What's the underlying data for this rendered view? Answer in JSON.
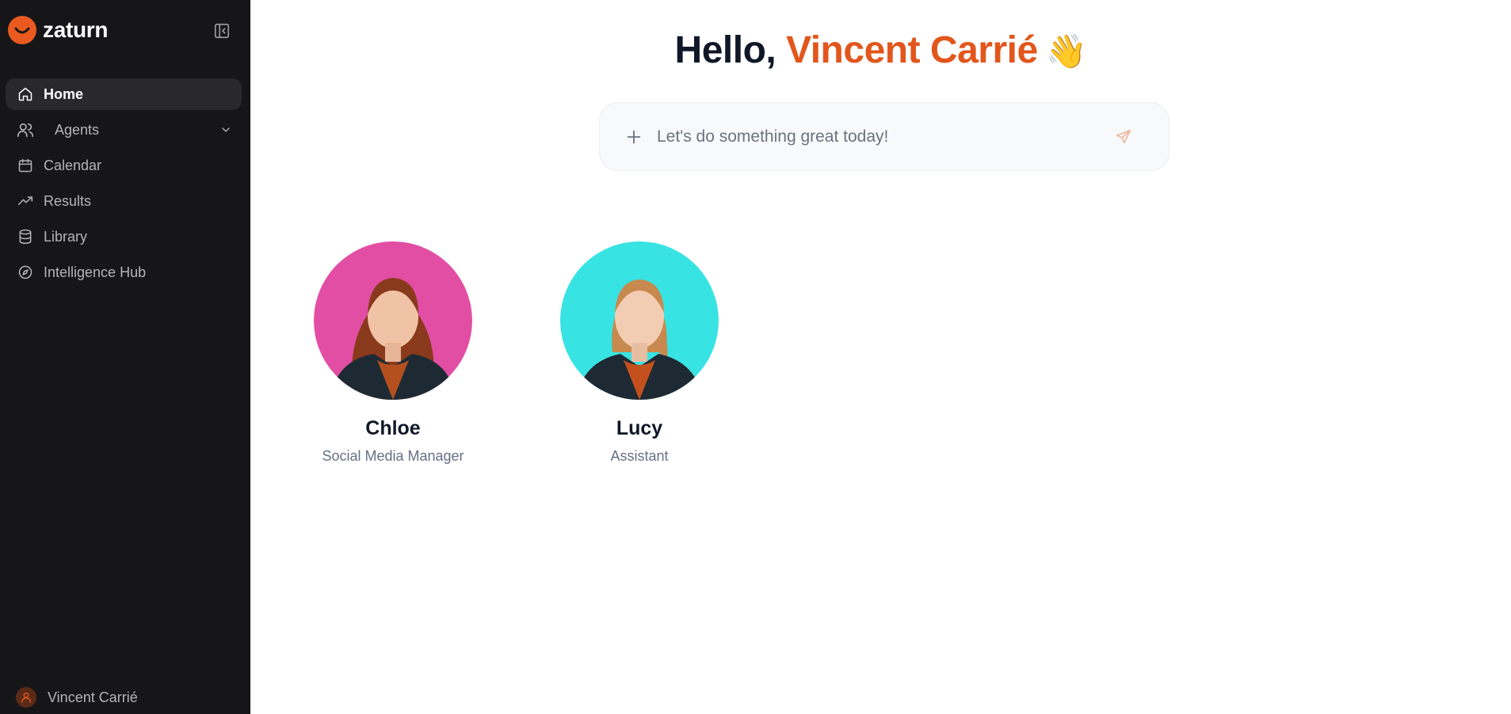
{
  "brand": {
    "name": "zaturn",
    "accent": "#ea5a20"
  },
  "sidebar": {
    "items": [
      {
        "label": "Home",
        "icon": "home-icon",
        "active": true
      },
      {
        "label": "Agents",
        "icon": "users-icon"
      },
      {
        "label": "Calendar",
        "icon": "calendar-icon"
      },
      {
        "label": "Results",
        "icon": "trending-up-icon"
      },
      {
        "label": "Library",
        "icon": "database-icon"
      },
      {
        "label": "Intelligence Hub",
        "icon": "compass-icon"
      }
    ],
    "user": {
      "name": "Vincent Carrié"
    }
  },
  "main": {
    "greeting": {
      "prefix": "Hello, ",
      "name": "Vincent Carrié",
      "emoji": "👋"
    },
    "prompt": {
      "placeholder": "Let's do something great today!"
    },
    "agents": [
      {
        "name": "Chloe",
        "role": "Social Media Manager",
        "bg_color": "#e24ea4",
        "hair_color": "#8a3a1c"
      },
      {
        "name": "Lucy",
        "role": "Assistant",
        "bg_color": "#38e3e3",
        "hair_color": "#c7894e"
      }
    ]
  }
}
